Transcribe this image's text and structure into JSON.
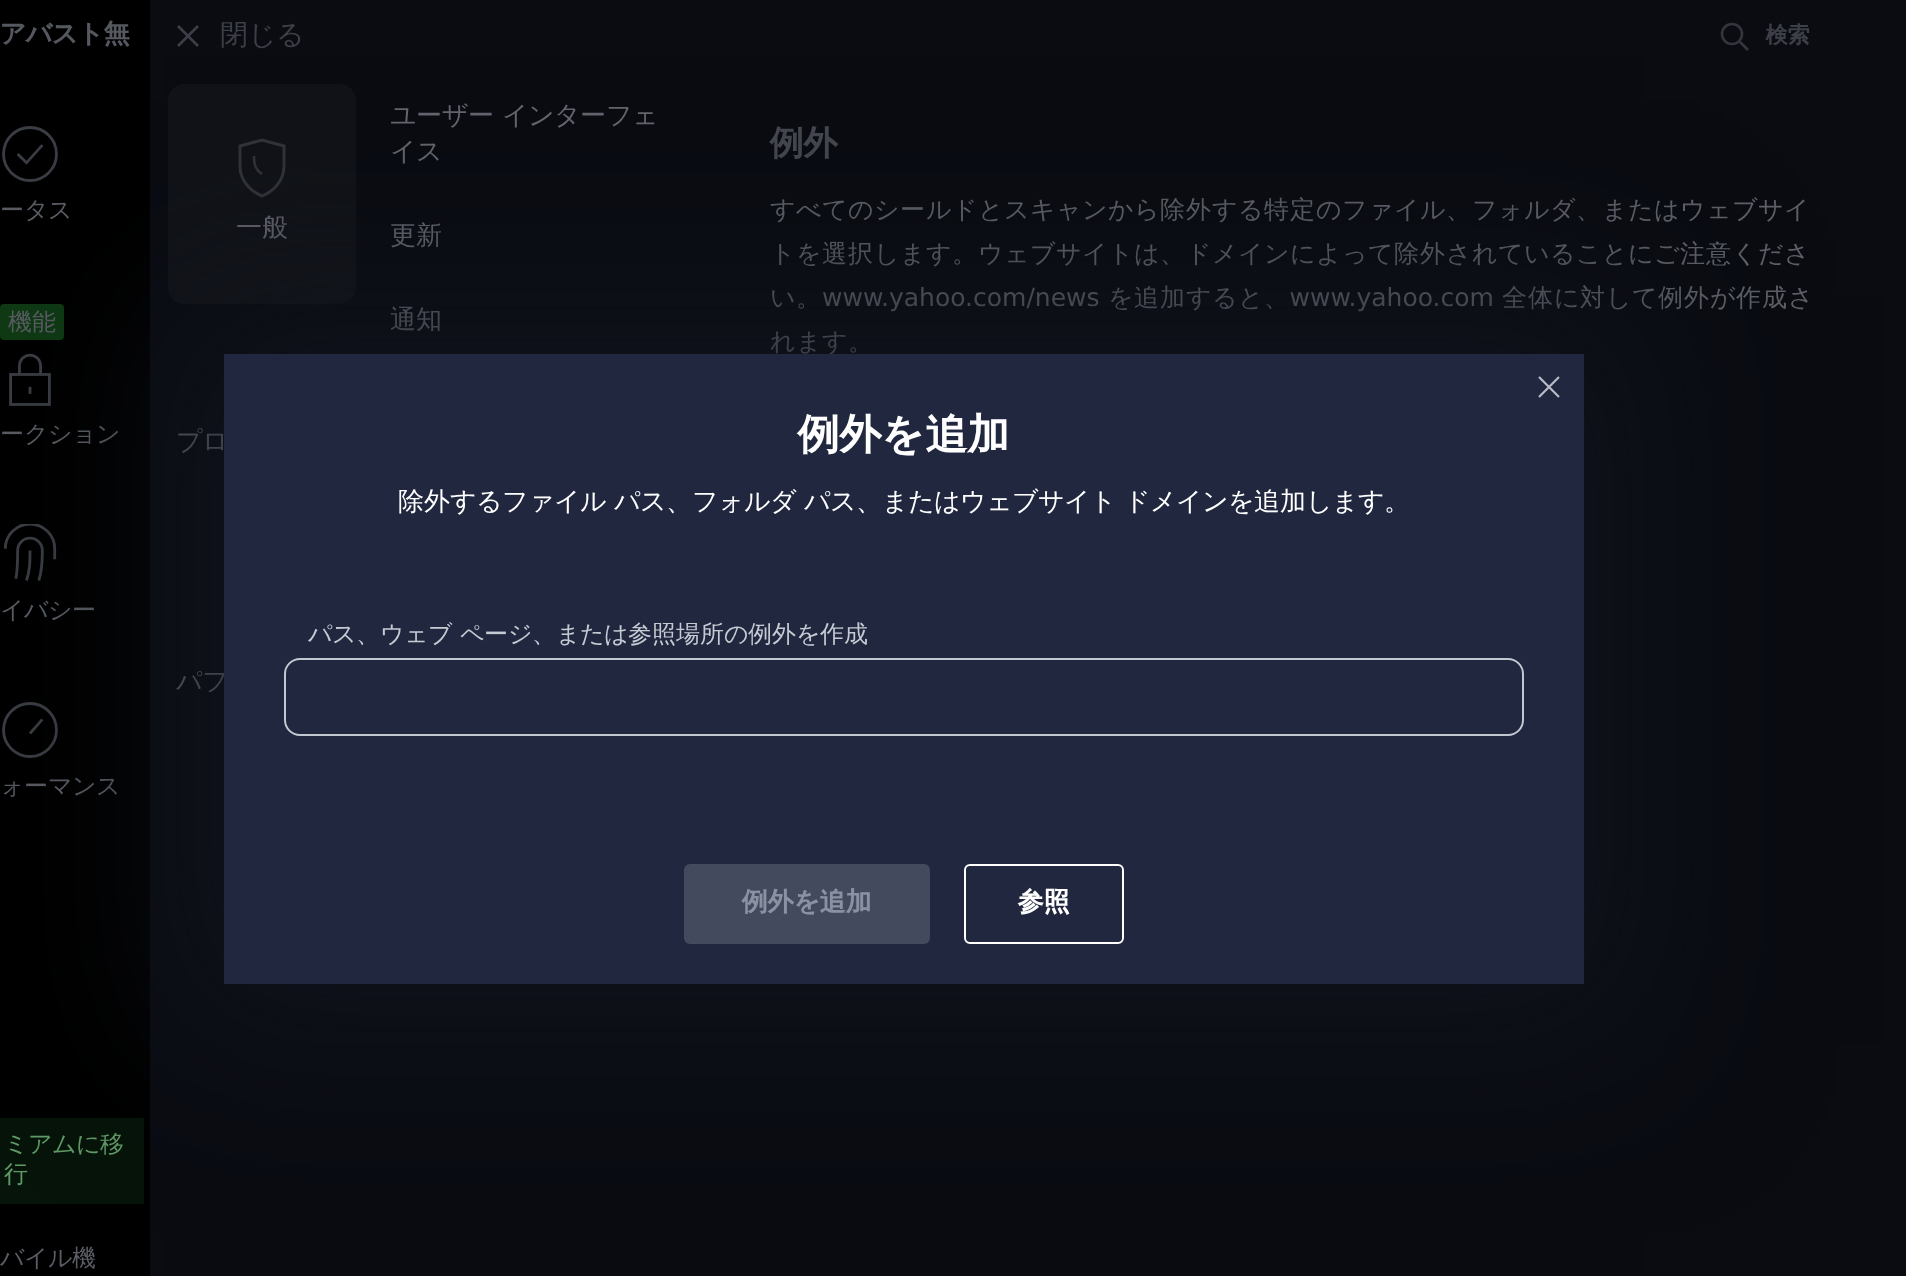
{
  "app_sidebar": {
    "title": "アバスト無",
    "badge": "機能",
    "items": [
      {
        "label": "ータス"
      },
      {
        "label": "ークション"
      },
      {
        "label": "イバシー"
      },
      {
        "label": "ォーマンス"
      }
    ],
    "upgrade": "ミアムに移行",
    "footer": "バイル機"
  },
  "settings": {
    "close_label": "閉じる",
    "search_label": "検索",
    "categories": [
      {
        "label": "一般",
        "selected": true
      },
      {
        "label": "プロ",
        "selected": false
      },
      {
        "label": "パフ",
        "selected": false
      }
    ],
    "submenu": [
      "ユーザー インターフェイス",
      "更新",
      "通知"
    ],
    "heading": "例外",
    "description": "すべてのシールドとスキャンから除外する特定のファイル、フォルダ、またはウェブサイトを選択します。ウェブサイトは、ドメインによって除外されていることにご注意ください。www.yahoo.com/news を追加すると、www.yahoo.com 全体に対して例外が作成されます。"
  },
  "dialog": {
    "title": "例外を追加",
    "subtitle": "除外するファイル パス、フォルダ パス、またはウェブサイト ドメインを追加します。",
    "field_label": "パス、ウェブ ページ、または参照場所の例外を作成",
    "buttons": [
      {
        "label": "例外を追加",
        "disabled": true
      },
      {
        "label": "参照",
        "disabled": false
      }
    ]
  }
}
